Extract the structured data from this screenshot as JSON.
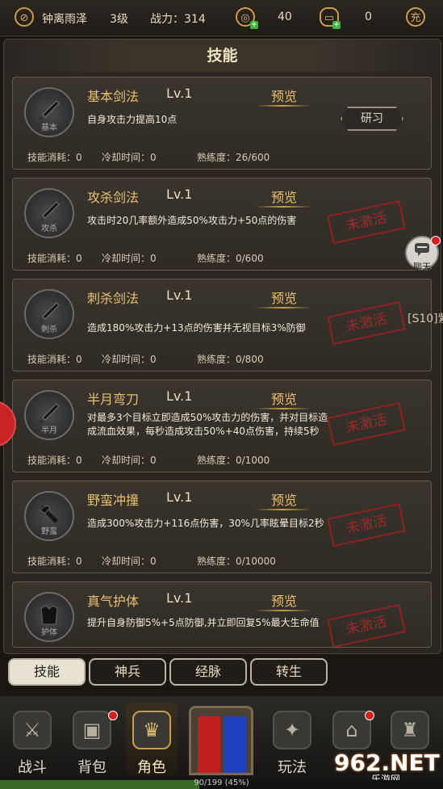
{
  "topbar": {
    "player_name": "钟离雨泽",
    "level": "3级",
    "power_label": "战力：314",
    "gold": "40",
    "ingot": "0",
    "recharge_label": "充"
  },
  "panel_title": "技能",
  "skills": [
    {
      "name": "基本剑法",
      "level": "Lv.1",
      "preview": "预览",
      "desc": "自身攻击力提高10点",
      "tag": "基本",
      "cost": "技能消耗：0",
      "cooldown": "冷却时间：0",
      "mastery": "熟练度：26/600",
      "action": "研习"
    },
    {
      "name": "攻杀剑法",
      "level": "Lv.1",
      "preview": "预览",
      "desc": "攻击时20几率额外造成50%攻击力+50点的伤害",
      "tag": "攻杀",
      "cost": "技能消耗：0",
      "cooldown": "冷却时间：0",
      "mastery": "熟练度：0/600",
      "status": "未激活"
    },
    {
      "name": "刺杀剑法",
      "level": "Lv.1",
      "preview": "预览",
      "desc": "造成180%攻击力+13点的伤害并无视目标3%防御",
      "tag": "刺杀",
      "cost": "技能消耗：0",
      "cooldown": "冷却时间：0",
      "mastery": "熟练度：0/800",
      "status": "未激活"
    },
    {
      "name": "半月弯刀",
      "level": "Lv.1",
      "preview": "预览",
      "desc": "对最多3个目标立即造成50%攻击力的伤害，并对目标造成流血效果，每秒造成攻击50%+40点伤害，持续5秒",
      "tag": "半月",
      "cost": "技能消耗：0",
      "cooldown": "冷却时间：0",
      "mastery": "熟练度：0/1000",
      "status": "未激活"
    },
    {
      "name": "野蛮冲撞",
      "level": "Lv.1",
      "preview": "预览",
      "desc": "造成300%攻击力+116点伤害，30%几率眩晕目标2秒",
      "tag": "野蛮",
      "cost": "技能消耗：0",
      "cooldown": "冷却时间：0",
      "mastery": "熟练度：0/10000",
      "status": "未激活"
    },
    {
      "name": "真气护体",
      "level": "Lv.1",
      "preview": "预览",
      "desc": "提升自身防御5%+5点防御,并立即回复5%最大生命值",
      "tag": "护体",
      "status": "未激活"
    }
  ],
  "tabs": [
    "技能",
    "神兵",
    "经脉",
    "转生"
  ],
  "nav": [
    {
      "label": "战斗",
      "icon": "swords-icon"
    },
    {
      "label": "背包",
      "icon": "bag-icon"
    },
    {
      "label": "角色",
      "icon": "helmet-icon"
    },
    {
      "label": "",
      "icon": "gate-icon"
    },
    {
      "label": "玩法",
      "icon": "sword-circle-icon"
    },
    {
      "label": "",
      "icon": "chest-icon"
    },
    {
      "label": "",
      "icon": "tower-icon"
    }
  ],
  "xp": {
    "text": "90/199 (45%)",
    "fraction": 0.45
  },
  "chat_label": "聊天",
  "side_message": "[S10]紫",
  "watermark": "962.NET",
  "watermark_sub": "乐游网"
}
